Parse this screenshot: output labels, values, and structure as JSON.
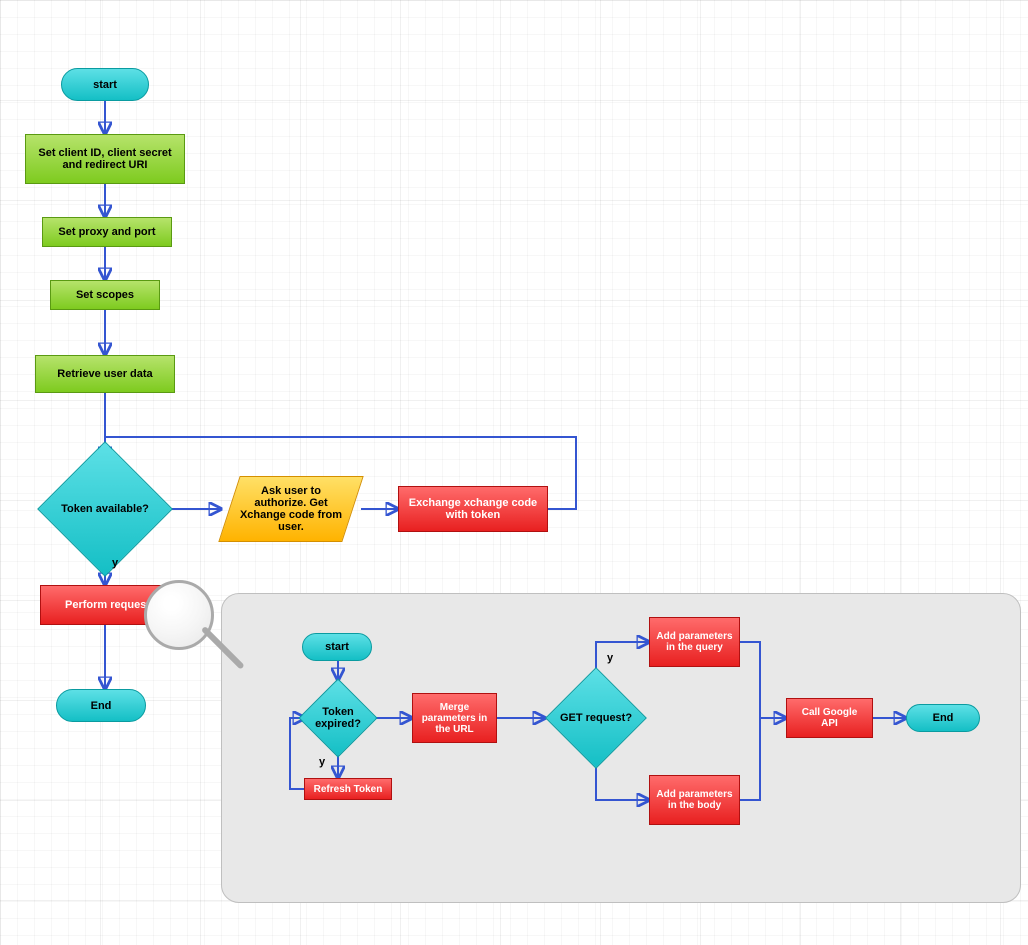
{
  "main": {
    "start": "start",
    "set_client": "Set client ID, client secret and redirect URI",
    "set_proxy": "Set proxy and port",
    "set_scopes": "Set scopes",
    "retrieve_user": "Retrieve user data",
    "token_available": "Token available?",
    "ask_user": "Ask user to authorize. Get Xchange code from user.",
    "exchange_code": "Exchange xchange code with token",
    "perform_request": "Perform request",
    "end": "End"
  },
  "sub": {
    "start": "start",
    "token_expired": "Token expired?",
    "refresh_token": "Refresh Token",
    "merge_params": "Merge parameters in the URL",
    "get_request": "GET request?",
    "add_query": "Add parameters in the query",
    "add_body": "Add parameters in the body",
    "call_api": "Call Google API",
    "end": "End"
  },
  "labels": {
    "y": "y"
  },
  "colors": {
    "arrow": "#3455d1",
    "term_fill": "#14bfc5",
    "proc_fill": "#7ecb1f",
    "red_fill": "#e82020",
    "para_fill": "#ffb300",
    "sub_bg": "#e8e8e8"
  }
}
